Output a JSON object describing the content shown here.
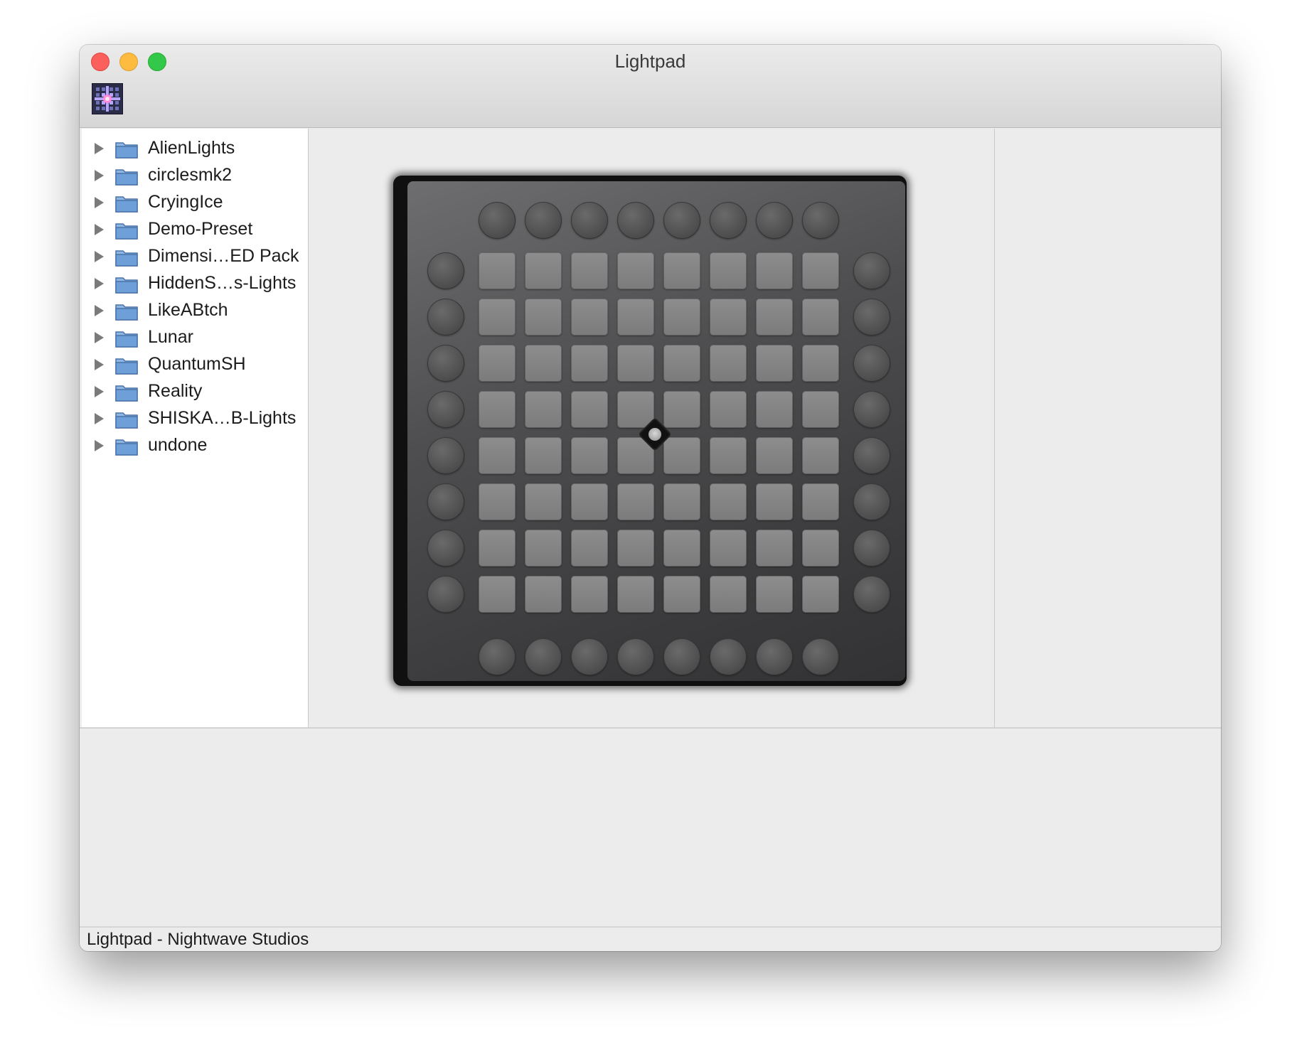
{
  "window": {
    "title": "Lightpad",
    "toolbar_icon": "lightpad-app-icon"
  },
  "sidebar": {
    "items": [
      {
        "label": "AlienLights",
        "icon": "folder-icon"
      },
      {
        "label": "circlesmk2",
        "icon": "folder-icon"
      },
      {
        "label": "CryingIce",
        "icon": "folder-icon"
      },
      {
        "label": "Demo-Preset",
        "icon": "folder-icon"
      },
      {
        "label": "Dimensi…ED Pack",
        "icon": "folder-icon"
      },
      {
        "label": "HiddenS…s-Lights",
        "icon": "folder-icon"
      },
      {
        "label": "LikeABtch",
        "icon": "folder-icon"
      },
      {
        "label": "Lunar",
        "icon": "folder-icon"
      },
      {
        "label": "QuantumSH",
        "icon": "folder-icon"
      },
      {
        "label": "Reality",
        "icon": "folder-icon"
      },
      {
        "label": "SHISKA…B-Lights",
        "icon": "folder-icon"
      },
      {
        "label": "undone",
        "icon": "folder-icon"
      }
    ]
  },
  "launchpad": {
    "grid_rows": 8,
    "grid_cols": 8,
    "top_buttons": 8,
    "bottom_buttons": 8,
    "left_buttons": 8,
    "right_buttons": 8,
    "logo_icon": "novation-logo-icon"
  },
  "status": {
    "text": "Lightpad - Nightwave Studios"
  },
  "colors": {
    "close": "#fc605c",
    "minimize": "#fdbc40",
    "zoom": "#34c84a",
    "folder": "#6f9fd8",
    "pad": "#858585",
    "round_button": "#555555"
  }
}
